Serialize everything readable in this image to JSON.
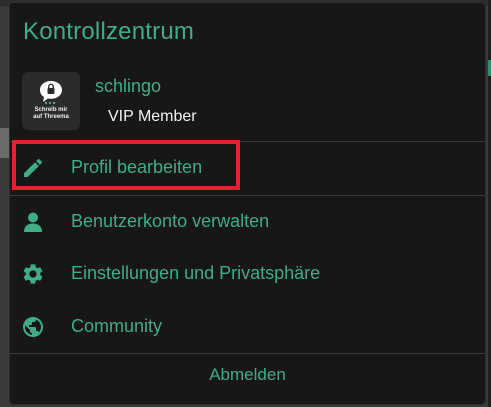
{
  "panel": {
    "title": "Kontrollzentrum"
  },
  "profile": {
    "avatar_text": "Schreib mir auf Threema",
    "username": "schlingo",
    "member_status": "VIP Member"
  },
  "menu": {
    "items": [
      {
        "label": "Profil bearbeiten",
        "icon": "pencil-icon"
      },
      {
        "label": "Benutzerkonto verwalten",
        "icon": "user-icon"
      },
      {
        "label": "Einstellungen und Privatsphäre",
        "icon": "gear-icon"
      },
      {
        "label": "Community",
        "icon": "globe-icon"
      }
    ],
    "logout_label": "Abmelden"
  },
  "colors": {
    "accent": "#3fae86",
    "panel_bg": "#171717",
    "highlight": "#e0262c"
  }
}
